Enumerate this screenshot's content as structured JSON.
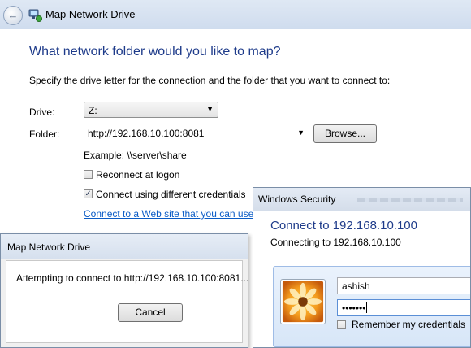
{
  "main_window": {
    "title": "Map Network Drive",
    "heading": "What network folder would you like to map?",
    "instructions": "Specify the drive letter for the connection and the folder that you want to connect to:",
    "drive_label": "Drive:",
    "drive_value": "Z:",
    "folder_label": "Folder:",
    "folder_value": "http://192.168.10.100:8081",
    "browse_label": "Browse...",
    "example_text": "Example: \\\\server\\share",
    "reconnect_label": "Reconnect at logon",
    "reconnect_checked": false,
    "diffcred_label": "Connect using different credentials",
    "diffcred_checked": true,
    "web_link": "Connect to a Web site that you can use to"
  },
  "progress_dialog": {
    "title": "Map Network Drive",
    "message": "Attempting to connect to http://192.168.10.100:8081...",
    "cancel_label": "Cancel"
  },
  "security_dialog": {
    "title": "Windows Security",
    "heading": "Connect to 192.168.10.100",
    "subheading": "Connecting to 192.168.10.100",
    "username_value": "ashish",
    "password_mask": "•••••••",
    "remember_label": "Remember my credentials",
    "remember_checked": false
  },
  "colors": {
    "heading_blue": "#1e3b8a",
    "link_blue": "#0b5cc6",
    "titlebar": "#d4ddea"
  },
  "icons": {
    "back": "back-arrow-icon",
    "network_drive": "network-drive-icon",
    "avatar": "user-avatar-flower-icon"
  }
}
